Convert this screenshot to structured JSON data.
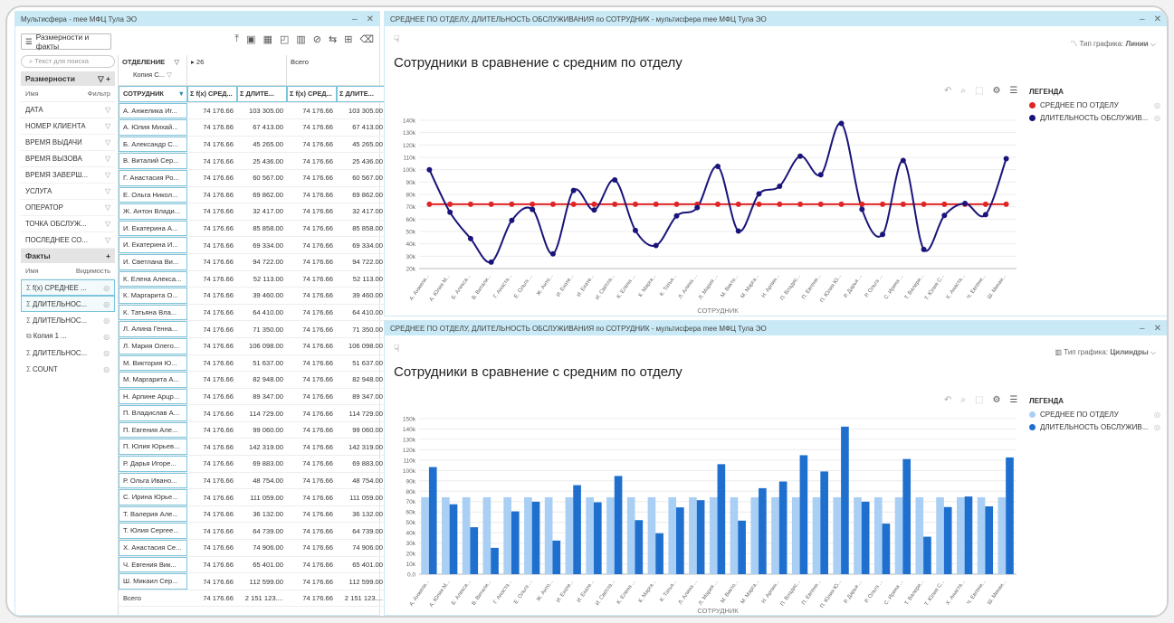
{
  "left_window": {
    "title": "Мультисфера - mee МФЦ Тула ЭО",
    "dims_button": "Размерности и факты",
    "search_placeholder": "Текст для поиска",
    "dims_header": "Размерности",
    "col_name": "Имя",
    "col_filter": "Фильтр",
    "dimensions": [
      "ДАТА",
      "НОМЕР КЛИЕНТА",
      "ВРЕМЯ ВЫДАЧИ",
      "ВРЕМЯ ВЫЗОВА",
      "ВРЕМЯ ЗАВЕРШ...",
      "УСЛУГА",
      "ОПЕРАТОР",
      "ТОЧКА ОБСЛУЖ...",
      "ПОСЛЕДНЕЕ СО..."
    ],
    "facts_header": "Факты",
    "col_visibility": "Видимость",
    "facts": [
      "f(x) СРЕДНЕЕ ...",
      "ДЛИТЕЛЬНОС...",
      "ДЛИТЕЛЬНОС...",
      "Копия 1 ...",
      "ДЛИТЕЛЬНОС...",
      "COUNT"
    ]
  },
  "pivot": {
    "col_dim": "ОТДЕЛЕНИЕ",
    "copy_label": "Копия С...",
    "col_value": "26",
    "total_label": "Всего",
    "row_dim": "СОТРУДНИК",
    "measures": [
      "f(x) СРЕД...",
      "ДЛИТЕ...",
      "f(x) СРЕД...",
      "ДЛИТЕ..."
    ],
    "rows": [
      [
        "А. Анжелика Иг...",
        "74 176.66",
        "103 305.00",
        "74 176.66",
        "103 305.00"
      ],
      [
        "А. Юлия Михай...",
        "74 176.66",
        "67 413.00",
        "74 176.66",
        "67 413.00"
      ],
      [
        "Б. Александр С...",
        "74 176.66",
        "45 265.00",
        "74 176.66",
        "45 265.00"
      ],
      [
        "В. Виталий Сер...",
        "74 176.66",
        "25 436.00",
        "74 176.66",
        "25 436.00"
      ],
      [
        "Г. Анастасия Ро...",
        "74 176.66",
        "60 567.00",
        "74 176.66",
        "60 567.00"
      ],
      [
        "Е. Ольга Никол...",
        "74 176.66",
        "69 862.00",
        "74 176.66",
        "69 862.00"
      ],
      [
        "Ж. Антон Влади...",
        "74 176.66",
        "32 417.00",
        "74 176.66",
        "32 417.00"
      ],
      [
        "И. Екатерина А...",
        "74 176.66",
        "85 858.00",
        "74 176.66",
        "85 858.00"
      ],
      [
        "И. Екатерина И...",
        "74 176.66",
        "69 334.00",
        "74 176.66",
        "69 334.00"
      ],
      [
        "И. Светлана Ви...",
        "74 176.66",
        "94 722.00",
        "74 176.66",
        "94 722.00"
      ],
      [
        "К. Елена Алекса...",
        "74 176.66",
        "52 113.00",
        "74 176.66",
        "52 113.00"
      ],
      [
        "К. Маргарита О...",
        "74 176.66",
        "39 460.00",
        "74 176.66",
        "39 460.00"
      ],
      [
        "К. Татьяна Вла...",
        "74 176.66",
        "64 410.00",
        "74 176.66",
        "64 410.00"
      ],
      [
        "Л. Алина Генна...",
        "74 176.66",
        "71 350.00",
        "74 176.66",
        "71 350.00"
      ],
      [
        "Л. Мария Олего...",
        "74 176.66",
        "106 098.00",
        "74 176.66",
        "106 098.00"
      ],
      [
        "М. Виктория Ю...",
        "74 176.66",
        "51 637.00",
        "74 176.66",
        "51 637.00"
      ],
      [
        "М. Маргарита А...",
        "74 176.66",
        "82 948.00",
        "74 176.66",
        "82 948.00"
      ],
      [
        "Н. Арпине Арцр...",
        "74 176.66",
        "89 347.00",
        "74 176.66",
        "89 347.00"
      ],
      [
        "П. Владислав А...",
        "74 176.66",
        "114 729.00",
        "74 176.66",
        "114 729.00"
      ],
      [
        "П. Евгения Але...",
        "74 176.66",
        "99 060.00",
        "74 176.66",
        "99 060.00"
      ],
      [
        "П. Юлия Юрьев...",
        "74 176.66",
        "142 319.00",
        "74 176.66",
        "142 319.00"
      ],
      [
        "Р. Дарья Игоре...",
        "74 176.66",
        "69 883.00",
        "74 176.66",
        "69 883.00"
      ],
      [
        "Р. Ольга Ивано...",
        "74 176.66",
        "48 754.00",
        "74 176.66",
        "48 754.00"
      ],
      [
        "С. Ирина Юрье...",
        "74 176.66",
        "111 059.00",
        "74 176.66",
        "111 059.00"
      ],
      [
        "Т. Валерия Але...",
        "74 176.66",
        "36 132.00",
        "74 176.66",
        "36 132.00"
      ],
      [
        "Т. Юлия Сергее...",
        "74 176.66",
        "64 739.00",
        "74 176.66",
        "64 739.00"
      ],
      [
        "Х. Анастасия Се...",
        "74 176.66",
        "74 906.00",
        "74 176.66",
        "74 906.00"
      ],
      [
        "Ч. Евгения Вик...",
        "74 176.66",
        "65 401.00",
        "74 176.66",
        "65 401.00"
      ],
      [
        "Ш. Микаил Сер...",
        "74 176.66",
        "112 599.00",
        "74 176.66",
        "112 599.00"
      ],
      [
        "Всего",
        "74 176.66",
        "2 151 123....",
        "74 176.66",
        "2 151 123...."
      ]
    ]
  },
  "top_window": {
    "title": "СРЕДНЕЕ ПО ОТДЕЛУ, ДЛИТЕЛЬНОСТЬ ОБСЛУЖИВАНИЯ по СОТРУДНИК - мультисфера mee МФЦ Тула ЭО",
    "chart_title": "Сотрудники в сравнение с средним по отделу",
    "type_label": "Тип графика:",
    "type_value": "Линии"
  },
  "bottom_window": {
    "title": "СРЕДНЕЕ ПО ОТДЕЛУ, ДЛИТЕЛЬНОСТЬ ОБСЛУЖИВАНИЯ по СОТРУДНИК - мультисфера mee МФЦ Тула ЭО",
    "chart_title": "Сотрудники в сравнение с средним по отделу",
    "type_label": "Тип графика:",
    "type_value": "Цилиндры"
  },
  "legend": {
    "title": "ЛЕГЕНДА"
  },
  "chart_data": [
    {
      "type": "line",
      "xlabel": "СОТРУДНИК",
      "ylim": [
        20000,
        145000
      ],
      "yticks": [
        "20k",
        "30k",
        "40k",
        "50k",
        "60k",
        "70k",
        "80k",
        "90k",
        "100k",
        "110k",
        "120k",
        "130k",
        "140k"
      ],
      "categories": [
        "А. Анжели...",
        "А. Юлия М...",
        "Б. Алекса...",
        "В. Витали...",
        "Г. Анаста...",
        "Е. Ольга ...",
        "Ж. Анто...",
        "И. Екате...",
        "И. Екате...",
        "И. Светла...",
        "К. Елена ...",
        "К. Марга...",
        "К. Татья...",
        "Л. Алина ...",
        "Л. Мария ...",
        "М. Викто...",
        "М. Марга...",
        "Н. Арпин...",
        "П. Владис...",
        "П. Евгени...",
        "П. Юлия Ю...",
        "Р. Дарья ...",
        "Р. Ольга ...",
        "С. Ирина ...",
        "Т. Валери...",
        "Т. Юлия С...",
        "Х. Анаста...",
        "Ч. Евгени...",
        "Ш. Микаи..."
      ],
      "series": [
        {
          "name": "СРЕДНЕЕ ПО ОТДЕЛУ",
          "color": "#e02424",
          "values": [
            74176.66,
            74176.66,
            74176.66,
            74176.66,
            74176.66,
            74176.66,
            74176.66,
            74176.66,
            74176.66,
            74176.66,
            74176.66,
            74176.66,
            74176.66,
            74176.66,
            74176.66,
            74176.66,
            74176.66,
            74176.66,
            74176.66,
            74176.66,
            74176.66,
            74176.66,
            74176.66,
            74176.66,
            74176.66,
            74176.66,
            74176.66,
            74176.66,
            74176.66
          ]
        },
        {
          "name": "ДЛИТЕЛЬНОСТЬ ОБСЛУЖИВ...",
          "color": "#1a147a",
          "values": [
            103305,
            67413,
            45265,
            25436,
            60567,
            69862,
            32417,
            85858,
            69334,
            94722,
            52113,
            39460,
            64410,
            71350,
            106098,
            51637,
            82948,
            89347,
            114729,
            99060,
            142319,
            69883,
            48754,
            111059,
            36132,
            64739,
            74906,
            65401,
            112599
          ]
        }
      ]
    },
    {
      "type": "bar",
      "xlabel": "СОТРУДНИК",
      "ylim": [
        0,
        150000
      ],
      "yticks": [
        "0.0",
        "10k",
        "20k",
        "30k",
        "40k",
        "50k",
        "60k",
        "70k",
        "80k",
        "90k",
        "100k",
        "110k",
        "120k",
        "130k",
        "140k",
        "150k"
      ],
      "categories": [
        "А. Анжели...",
        "А. Юлия М...",
        "Б. Алекса...",
        "В. Витали...",
        "Г. Анаста...",
        "Е. Ольга ...",
        "Ж. Анто...",
        "И. Екате...",
        "И. Екате...",
        "И. Светла...",
        "К. Елена ...",
        "К. Марга...",
        "К. Татья...",
        "Л. Алина ...",
        "Л. Мария ...",
        "М. Викто...",
        "М. Марга...",
        "Н. Арпин...",
        "П. Владис...",
        "П. Евгени...",
        "П. Юлия Ю...",
        "Р. Дарья ...",
        "Р. Ольга ...",
        "С. Ирина ...",
        "Т. Валери...",
        "Т. Юлия С...",
        "Х. Анаста...",
        "Ч. Евгени...",
        "Ш. Микаи..."
      ],
      "series": [
        {
          "name": "СРЕДНЕЕ ПО ОТДЕЛУ",
          "color": "#a9cff5",
          "values": [
            74176.66,
            74176.66,
            74176.66,
            74176.66,
            74176.66,
            74176.66,
            74176.66,
            74176.66,
            74176.66,
            74176.66,
            74176.66,
            74176.66,
            74176.66,
            74176.66,
            74176.66,
            74176.66,
            74176.66,
            74176.66,
            74176.66,
            74176.66,
            74176.66,
            74176.66,
            74176.66,
            74176.66,
            74176.66,
            74176.66,
            74176.66,
            74176.66,
            74176.66
          ]
        },
        {
          "name": "ДЛИТЕЛЬНОСТЬ ОБСЛУЖИВ...",
          "color": "#1f6fcf",
          "values": [
            103305,
            67413,
            45265,
            25436,
            60567,
            69862,
            32417,
            85858,
            69334,
            94722,
            52113,
            39460,
            64410,
            71350,
            106098,
            51637,
            82948,
            89347,
            114729,
            99060,
            142319,
            69883,
            48754,
            111059,
            36132,
            64739,
            74906,
            65401,
            112599
          ]
        }
      ]
    }
  ]
}
